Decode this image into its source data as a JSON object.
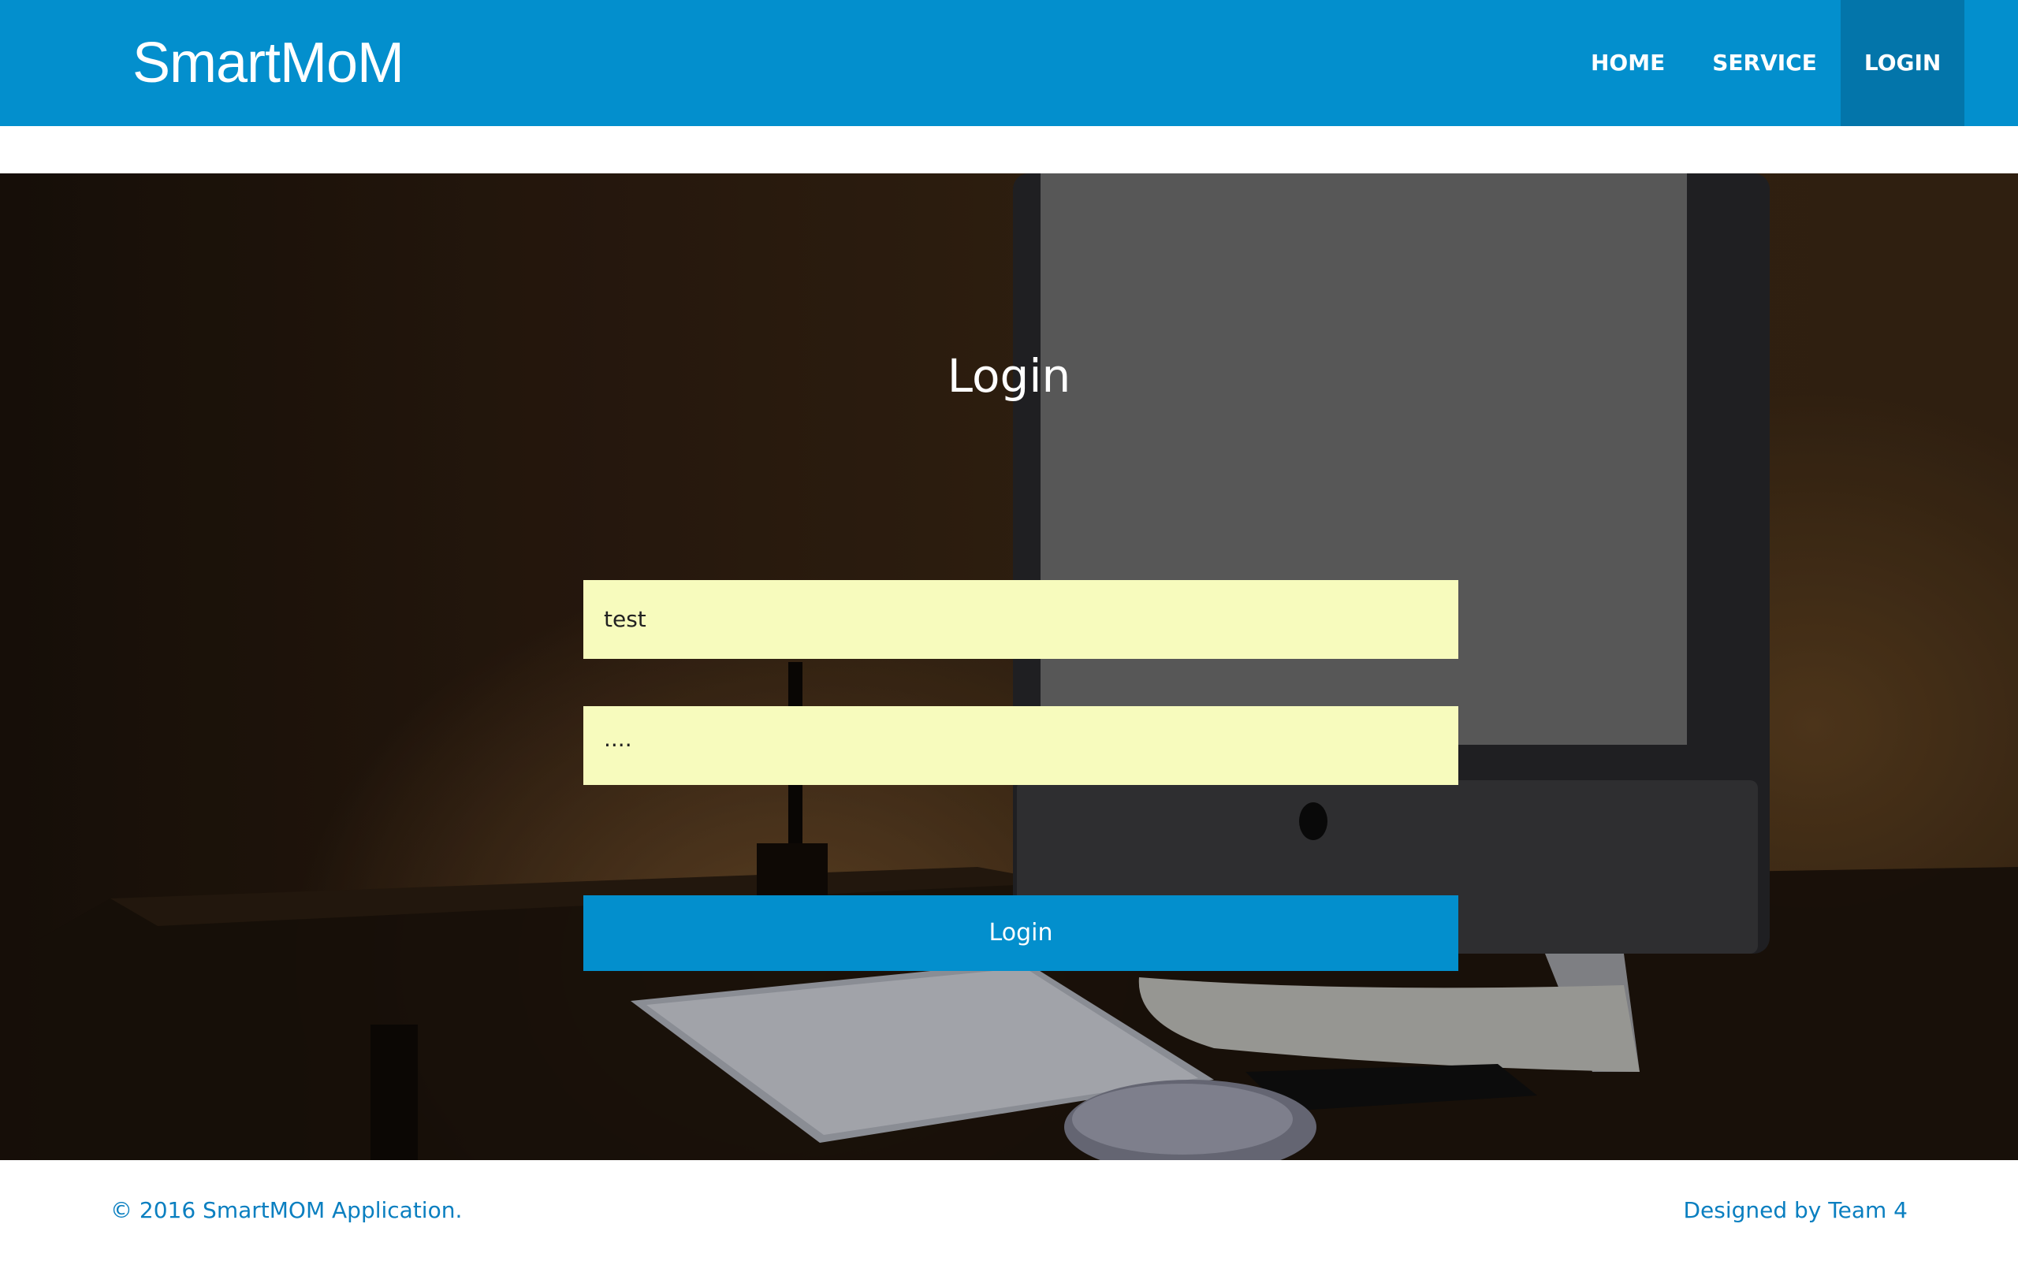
{
  "navbar": {
    "brand": "SmartMoM",
    "items": [
      {
        "label": "HOME",
        "active": false
      },
      {
        "label": "SERVICE",
        "active": false
      },
      {
        "label": "LOGIN",
        "active": true
      }
    ],
    "color": "#038fcd",
    "active_color": "#0375aa"
  },
  "login": {
    "title": "Login",
    "username_value": "test",
    "password_value": "····",
    "button_label": "Login",
    "field_background": "#f7fbbd"
  },
  "footer": {
    "copyright": "© 2016 SmartMOM Application.",
    "credit": "Designed by Team 4"
  },
  "hero": {
    "image_description": "desk-with-imac-keyboard-mouse-photo"
  }
}
